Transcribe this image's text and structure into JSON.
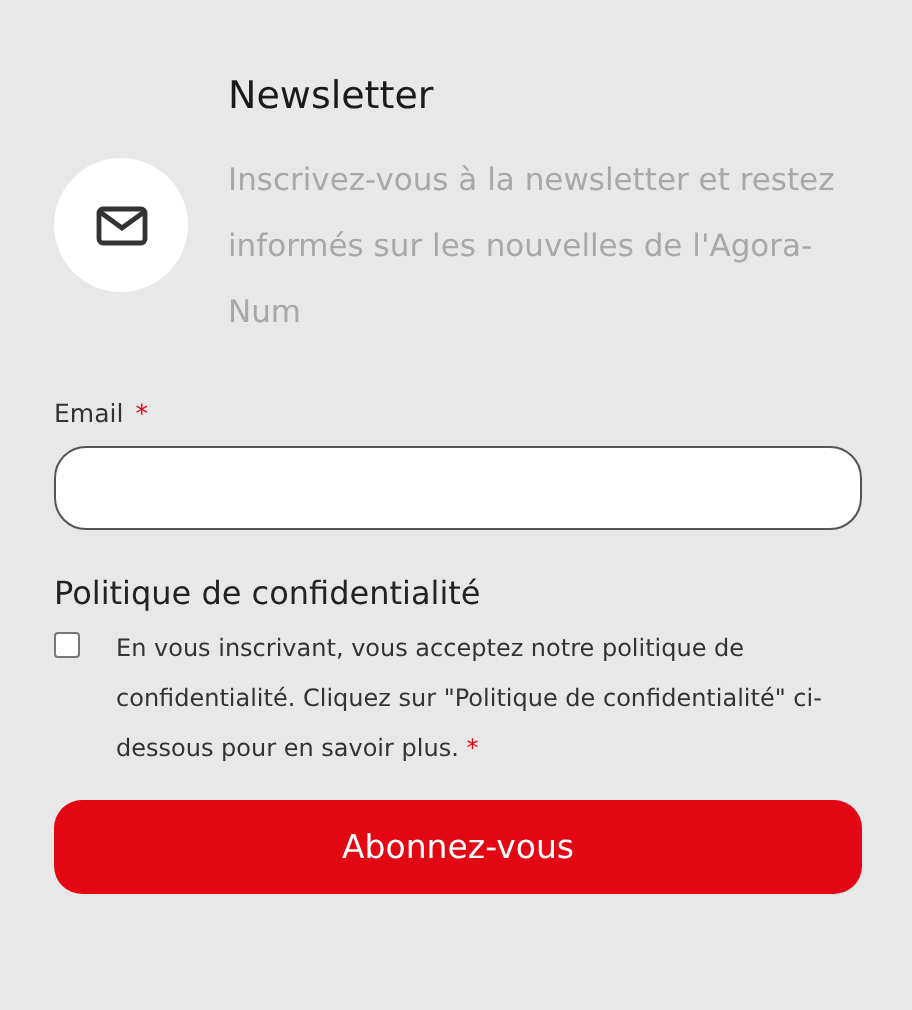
{
  "newsletter": {
    "title": "Newsletter",
    "description": "Inscrivez-vous à la newsletter et restez informés sur les nouvelles de l'Agora-Num"
  },
  "email_field": {
    "label": "Email",
    "required_mark": "*"
  },
  "privacy": {
    "heading": "Politique de confidentialité",
    "checked": false,
    "text": "En vous inscrivant, vous acceptez notre politique de confidentialité. Cliquez sur \"Politique de confidentialité\" ci-dessous pour en savoir plus.",
    "required_mark": "*"
  },
  "submit_button": {
    "label": "Abonnez-vous"
  }
}
